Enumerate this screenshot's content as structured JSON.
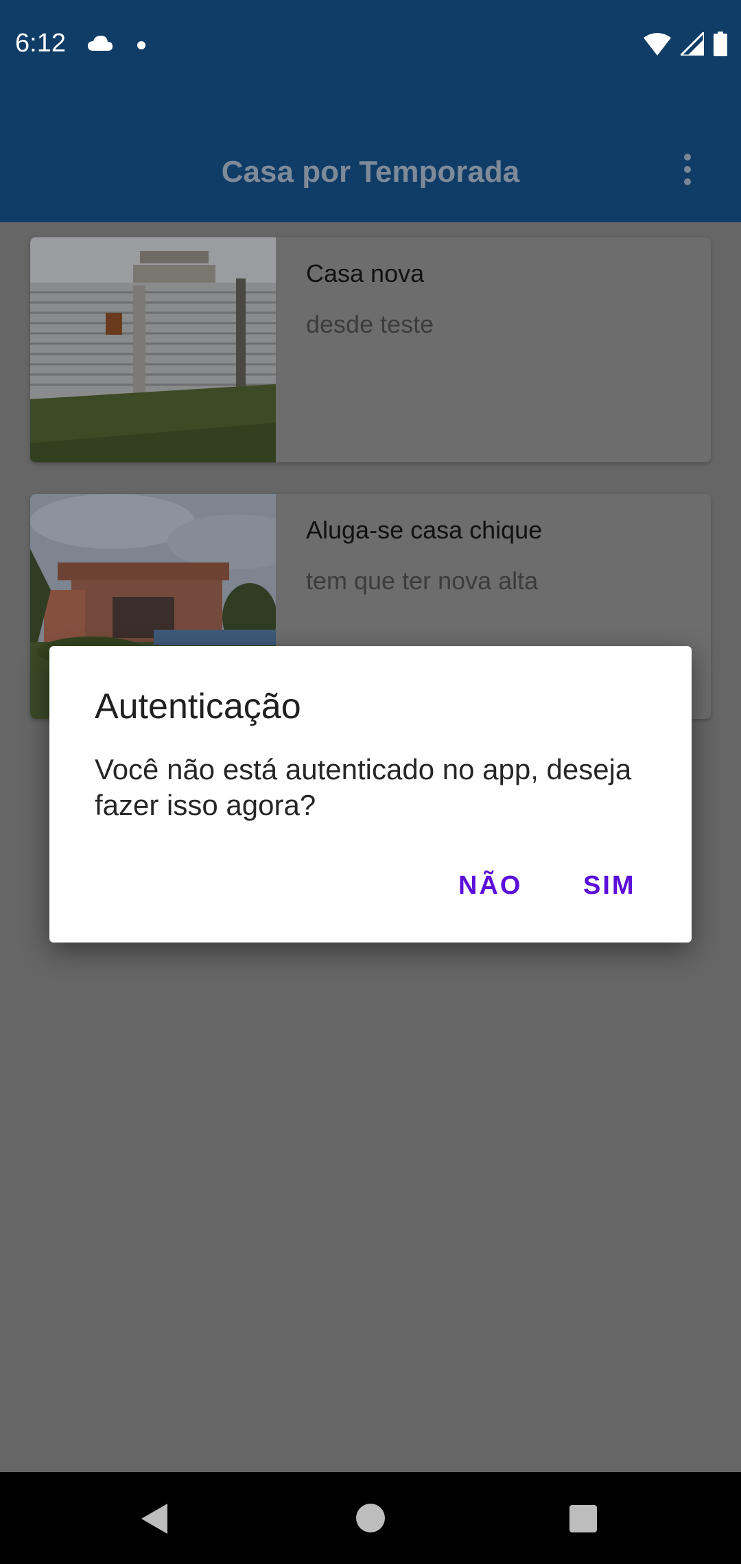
{
  "status_bar": {
    "time": "6:12",
    "icons": [
      "cloud-icon",
      "notification-dot-icon",
      "wifi-icon",
      "signal-icon",
      "battery-icon"
    ]
  },
  "app_bar": {
    "title": "Casa por Temporada",
    "menu_icon": "more-vert-icon"
  },
  "listings": [
    {
      "title": "Casa nova",
      "description": "desde teste",
      "image": "house-fence-photo"
    },
    {
      "title": "Aluga-se casa chique",
      "description": "tem que ter nova alta",
      "image": "modern-house-pool-photo"
    }
  ],
  "dialog": {
    "title": "Autenticação",
    "message": "Você não está autenticado no app, deseja fazer isso agora?",
    "negative_label": "NÃO",
    "positive_label": "SIM"
  },
  "nav_bar": {
    "icons": [
      "back-icon",
      "home-icon",
      "recents-icon"
    ]
  },
  "colors": {
    "app_bar": "#103d67",
    "scrim_background": "#666666",
    "dialog_button": "#5b0fd9"
  }
}
